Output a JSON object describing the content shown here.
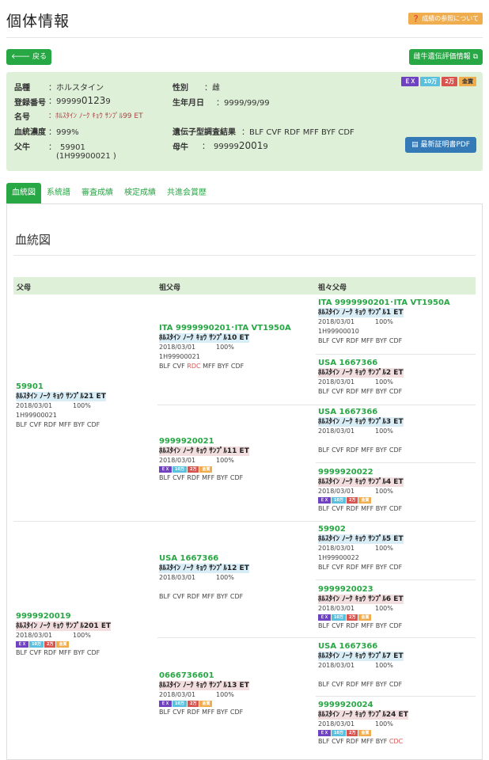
{
  "page": {
    "title": "個体情報",
    "help_label": "成績の参照について"
  },
  "buttons": {
    "back": "戻る",
    "genetic_eval": "雌牛遺伝評価情報",
    "pdf": "最新証明書PDF"
  },
  "info": {
    "breed_label": "品種",
    "breed": "：ホルスタイン",
    "reg_label": "登録番号",
    "reg_prefix": "：99999",
    "reg_big": "0123",
    "reg_suffix": "9",
    "name_label": "名号",
    "name": "：ﾎﾙｽﾀｲﾝ ﾉｰｸ ｷｮｳ ｻﾝﾌﾟﾙ99 ET",
    "blood_label": "血統濃度",
    "blood": "：999%",
    "sire_label": "父牛",
    "sire": "：　59901",
    "sire_sub": "(1H99900021 )",
    "sex_label": "性別",
    "sex": "：雌",
    "birth_label": "生年月日",
    "birth": "：9999/99/99",
    "gene_label": "遺伝子型調査結果",
    "gene": "：BLF CVF RDF MFF BYF CDF",
    "dam_label": "母牛",
    "dam_prefix": "：　99999",
    "dam_big": "2001",
    "dam_suffix": "9",
    "badges": [
      "ＥＸ",
      "10万",
      "2万",
      "金賞"
    ]
  },
  "tabs": [
    "血統図",
    "系統譜",
    "審査成績",
    "検定成績",
    "共進会賞歴"
  ],
  "pedigree": {
    "section_title": "血統図",
    "headers": [
      "父母",
      "祖父母",
      "祖々父母"
    ],
    "mini_badges": [
      "ＥＸ",
      "10万",
      "2万",
      "金賞"
    ],
    "parents": [
      {
        "id": "59901",
        "name": "ﾎﾙｽﾀｲﾝ ﾉｰｸ ｷｮｳ ｻﾝﾌﾟﾙ21 ET",
        "date": "2018/03/01",
        "pct": "100%",
        "code": "1H99900021",
        "genes": "BLF CVF RDF MFF BYF CDF"
      },
      {
        "id": "9999920019",
        "name": "ﾎﾙｽﾀｲﾝ ﾉｰｸ ｷｮｳ ｻﾝﾌﾟﾙ201 ET",
        "date": "2018/03/01",
        "pct": "100%",
        "genes": "BLF CVF RDF MFF BYF CDF"
      }
    ],
    "grandparents": [
      {
        "id": "ITA 9999990201･ITA VT1950A",
        "name": "ﾎﾙｽﾀｲﾝ ﾉｰｸ ｷｮｳ ｻﾝﾌﾟﾙ10 ET",
        "date": "2018/03/01",
        "pct": "100%",
        "code": "1H99900021",
        "genes_a": "BLF CVF ",
        "genes_red": "RDC",
        "genes_b": " MFF BYF CDF"
      },
      {
        "id": "9999920021",
        "name": "ﾎﾙｽﾀｲﾝ ﾉｰｸ ｷｮｳ ｻﾝﾌﾟﾙ11 ET",
        "date": "2018/03/01",
        "pct": "100%",
        "genes": "BLF CVF RDF MFF BYF CDF"
      },
      {
        "id": "USA 1667366",
        "name": "ﾎﾙｽﾀｲﾝ ﾉｰｸ ｷｮｳ ｻﾝﾌﾟﾙ12 ET",
        "date": "2018/03/01",
        "pct": "100%",
        "genes": "BLF CVF RDF MFF BYF CDF"
      },
      {
        "id": "0666736601",
        "name": "ﾎﾙｽﾀｲﾝ ﾉｰｸ ｷｮｳ ｻﾝﾌﾟﾙ13 ET",
        "date": "2018/03/01",
        "pct": "100%",
        "genes": "BLF CVF RDF MFF BYF CDF"
      }
    ],
    "great": [
      {
        "id": "ITA 9999990201･ITA VT1950A",
        "name": "ﾎﾙｽﾀｲﾝ ﾉｰｸ ｷｮｳ ｻﾝﾌﾟﾙ1 ET",
        "date": "2018/03/01",
        "pct": "100%",
        "code": "1H99900010",
        "genes": "BLF CVF RDF MFF BYF CDF"
      },
      {
        "id": "USA 1667366",
        "name": "ﾎﾙｽﾀｲﾝ ﾉｰｸ ｷｮｳ ｻﾝﾌﾟﾙ2 ET",
        "date": "2018/03/01",
        "pct": "100%",
        "genes": "BLF CVF RDF MFF BYF CDF"
      },
      {
        "id": "USA 1667366",
        "name": "ﾎﾙｽﾀｲﾝ ﾉｰｸ ｷｮｳ ｻﾝﾌﾟﾙ3 ET",
        "date": "2018/03/01",
        "pct": "100%",
        "genes": "BLF CVF RDF MFF BYF CDF"
      },
      {
        "id": "9999920022",
        "name": "ﾎﾙｽﾀｲﾝ ﾉｰｸ ｷｮｳ ｻﾝﾌﾟﾙ4 ET",
        "date": "2018/03/01",
        "pct": "100%",
        "genes": "BLF CVF RDF MFF BYF CDF"
      },
      {
        "id": "59902",
        "name": "ﾎﾙｽﾀｲﾝ ﾉｰｸ ｷｮｳ ｻﾝﾌﾟﾙ5 ET",
        "date": "2018/03/01",
        "pct": "100%",
        "code": "1H99900022",
        "genes": "BLF CVF RDF MFF BYF CDF"
      },
      {
        "id": "9999920023",
        "name": "ﾎﾙｽﾀｲﾝ ﾉｰｸ ｷｮｳ ｻﾝﾌﾟﾙ6 ET",
        "date": "2018/03/01",
        "pct": "100%",
        "genes": "BLF CVF RDF MFF BYF CDF"
      },
      {
        "id": "USA 1667366",
        "name": "ﾎﾙｽﾀｲﾝ ﾉｰｸ ｷｮｳ ｻﾝﾌﾟﾙ7 ET",
        "date": "2018/03/01",
        "pct": "100%",
        "genes": "BLF CVF RDF MFF BYF CDF"
      },
      {
        "id": "9999920024",
        "name": "ﾎﾙｽﾀｲﾝ ﾉｰｸ ｷｮｳ ｻﾝﾌﾟﾙ24 ET",
        "date": "2018/03/01",
        "pct": "100%",
        "genes_a": "BLF CVF RDF MFF BYF ",
        "genes_red": "CDC"
      }
    ]
  }
}
